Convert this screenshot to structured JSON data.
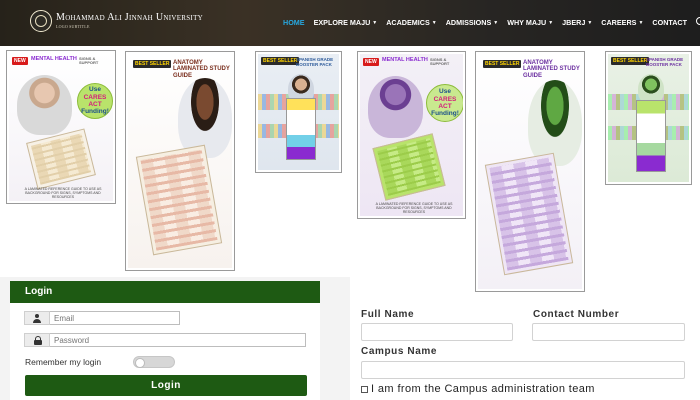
{
  "header": {
    "logo_title": "Mohammad Ali Jinnah University",
    "logo_subtitle": "LOGO SUBTITLE",
    "nav": [
      {
        "label": "HOME",
        "dropdown": false,
        "active": true
      },
      {
        "label": "EXPLORE MAJU",
        "dropdown": true,
        "active": false
      },
      {
        "label": "ACADEMICS",
        "dropdown": true,
        "active": false
      },
      {
        "label": "ADMISSIONS",
        "dropdown": true,
        "active": false
      },
      {
        "label": "WHY MAJU",
        "dropdown": true,
        "active": false
      },
      {
        "label": "JBERJ",
        "dropdown": true,
        "active": false
      },
      {
        "label": "CAREERS",
        "dropdown": true,
        "active": false
      },
      {
        "label": "CONTACT",
        "dropdown": false,
        "active": false
      }
    ],
    "search_icon": "search-icon"
  },
  "products": [
    {
      "badge": "NEW",
      "title": "MENTAL HEALTH",
      "subtitle": "SIGNS & SUPPORT",
      "promo": "Use",
      "promo_accent": "CARES ACT",
      "promo_end": "Funding!",
      "caption": "A LAMINATED REFERENCE GUIDE TO USE AS BACKGROUND FOR SIGNS, SYMPTOMS AND RESOURCES",
      "theme": "color"
    },
    {
      "badge": "BEST SELLER",
      "title": "ANATOMY LAMINATED STUDY GUIDE",
      "theme": "color"
    },
    {
      "badge": "BEST SELLER",
      "title": "SPANISH GRADE BOOSTER PACK",
      "theme": "color"
    },
    {
      "badge": "NEW",
      "title": "MENTAL HEALTH",
      "subtitle": "SIGNS & SUPPORT",
      "promo": "Use",
      "promo_accent": "CARES ACT",
      "promo_end": "Funding!",
      "caption": "A LAMINATED REFERENCE GUIDE TO USE AS BACKGROUND FOR SIGNS, SYMPTOMS AND RESOURCES",
      "theme": "purple"
    },
    {
      "badge": "BEST SELLER",
      "title": "ANATOMY LAMINATED STUDY GUIDE",
      "theme": "purple"
    },
    {
      "badge": "BEST SELLER",
      "title": "SPANISH GRADE BOOSTER PACK",
      "theme": "purple"
    }
  ],
  "login": {
    "title": "Login",
    "email_placeholder": "Email",
    "password_placeholder": "Password",
    "remember_label": "Remember my login",
    "remember_on": false,
    "button_label": "Login"
  },
  "contact_form": {
    "full_name_label": "Full Name",
    "contact_number_label": "Contact Number",
    "campus_name_label": "Campus Name",
    "admin_checkbox_label": "I am from the Campus administration team",
    "admin_checked": false
  },
  "colors": {
    "primary_green": "#1e5a13",
    "nav_active": "#27a8e0",
    "purple_accent": "#8a2bd0",
    "green_tint": "#7fdc56"
  }
}
